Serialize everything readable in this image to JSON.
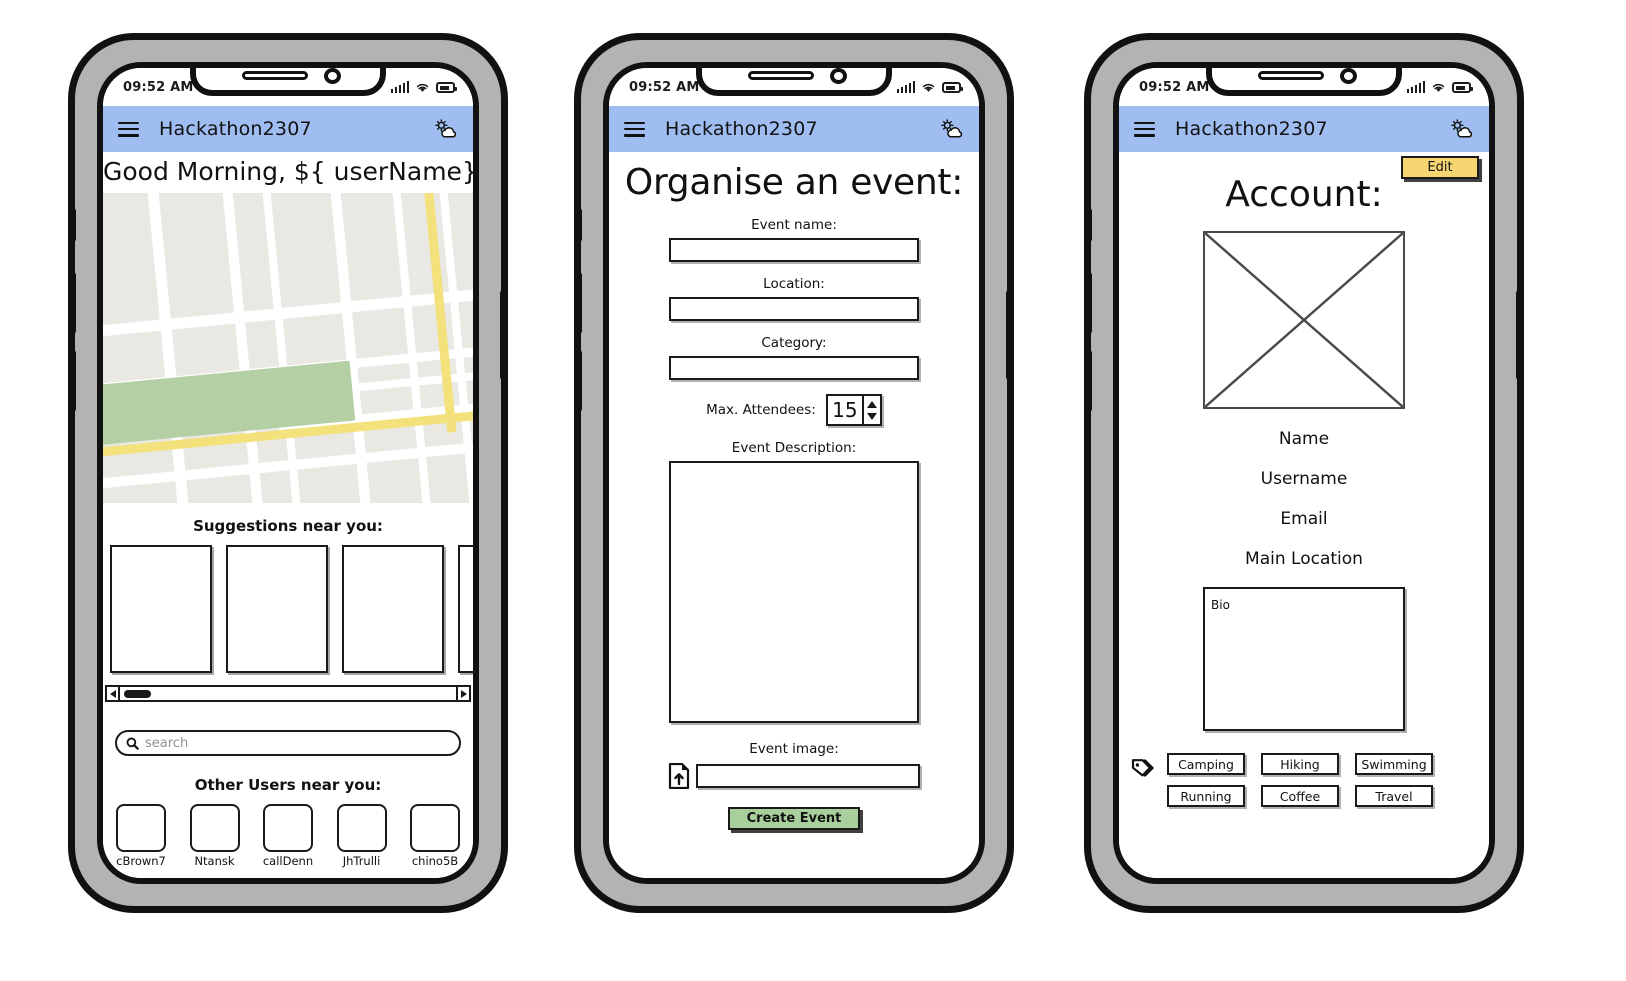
{
  "colors": {
    "appbar": "#9fbdf0",
    "primary_button": "#a9cf9c",
    "edit_button": "#f7d571",
    "map_land": "#e9e8e3",
    "map_highway": "#f3e17c",
    "map_park": "#b4cfa4",
    "outline": "#1a1a1a"
  },
  "status_bar": {
    "time": "09:52 AM",
    "signal_icon": "signal-bars-icon",
    "wifi_icon": "wifi-icon",
    "battery_icon": "battery-icon"
  },
  "app_bar": {
    "menu_icon": "hamburger-menu-icon",
    "title": "Hackathon2307",
    "weather_icon": "weather-cloud-sun-icon"
  },
  "screens": [
    {
      "id": "home",
      "greeting": "Good Morning, ${ userName}!",
      "map": {
        "icon": "map-view"
      },
      "suggestions": {
        "heading": "Suggestions near you:",
        "cards": [
          "",
          "",
          "",
          ""
        ],
        "scrollbar": {
          "left_arrow_icon": "scroll-left-arrow-icon",
          "right_arrow_icon": "scroll-right-arrow-icon"
        }
      },
      "search": {
        "icon": "search-icon",
        "placeholder": "search",
        "value": ""
      },
      "users": {
        "heading": "Other Users near you:",
        "items": [
          {
            "name": "cBrown7"
          },
          {
            "name": "Ntansk"
          },
          {
            "name": "callDenn"
          },
          {
            "name": "JhTrulli"
          },
          {
            "name": "chino5B"
          }
        ]
      }
    },
    {
      "id": "organise-event",
      "title": "Organise an event:",
      "fields": [
        {
          "label": "Event name:",
          "value": "",
          "type": "text"
        },
        {
          "label": "Location:",
          "value": "",
          "type": "text"
        },
        {
          "label": "Category:",
          "value": "",
          "type": "text"
        }
      ],
      "attendees": {
        "label": "Max. Attendees:",
        "value": "15",
        "increment_icon": "stepper-up-arrow-icon",
        "decrement_icon": "stepper-down-arrow-icon"
      },
      "description": {
        "label": "Event Description:",
        "value": ""
      },
      "image": {
        "label": "Event image:",
        "upload_icon": "file-upload-icon",
        "value": ""
      },
      "submit": {
        "label": "Create Event"
      }
    },
    {
      "id": "account",
      "edit_button": {
        "label": "Edit"
      },
      "title": "Account:",
      "avatar": {
        "icon": "image-placeholder-icon"
      },
      "fields": [
        {
          "label": "Name"
        },
        {
          "label": "Username"
        },
        {
          "label": "Email"
        },
        {
          "label": "Main Location"
        }
      ],
      "bio": {
        "placeholder": "Bio",
        "value": ""
      },
      "tags": {
        "icon": "tags-icon",
        "items": [
          "Camping",
          "Hiking",
          "Swimming",
          "Running",
          "Coffee",
          "Travel"
        ]
      }
    }
  ]
}
